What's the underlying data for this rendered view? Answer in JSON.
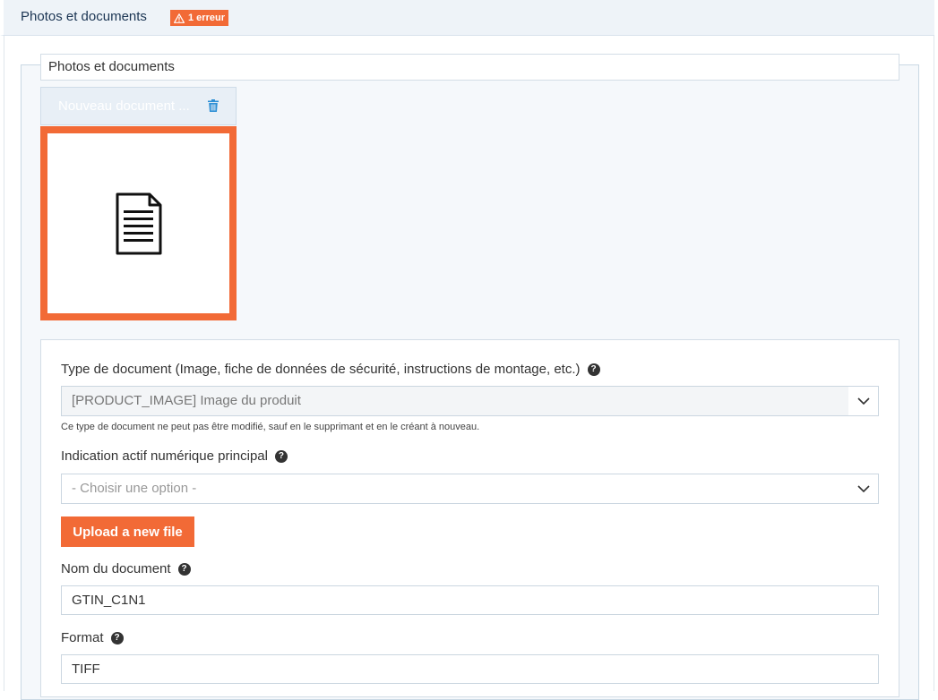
{
  "header": {
    "title": "Photos et documents",
    "error_badge": "1 erreur"
  },
  "fieldset": {
    "legend": "Photos et documents"
  },
  "document_card": {
    "title": "Nouveau document ..."
  },
  "form": {
    "doc_type_label": "Type de document (Image, fiche de données de sécurité, instructions de montage, etc.)",
    "doc_type_value": "[PRODUCT_IMAGE] Image du produit",
    "doc_type_help": "Ce type de document ne peut pas être modifié, sauf en le supprimant et en le créant à nouveau.",
    "digital_asset_label": "Indication actif numérique principal",
    "digital_asset_placeholder": "- Choisir une option -",
    "upload_button": "Upload a new file",
    "doc_name_label": "Nom du document",
    "doc_name_value": "GTIN_C1N1",
    "format_label": "Format",
    "format_value": "TIFF"
  },
  "icons": {
    "help": "?",
    "warning": "warning-icon",
    "trash": "trash-icon",
    "file": "document-file-icon",
    "chevron": "chevron-down-icon"
  },
  "colors": {
    "accent": "#f26a36",
    "header_bg": "#eef3f8",
    "title_color": "#1b3553"
  }
}
